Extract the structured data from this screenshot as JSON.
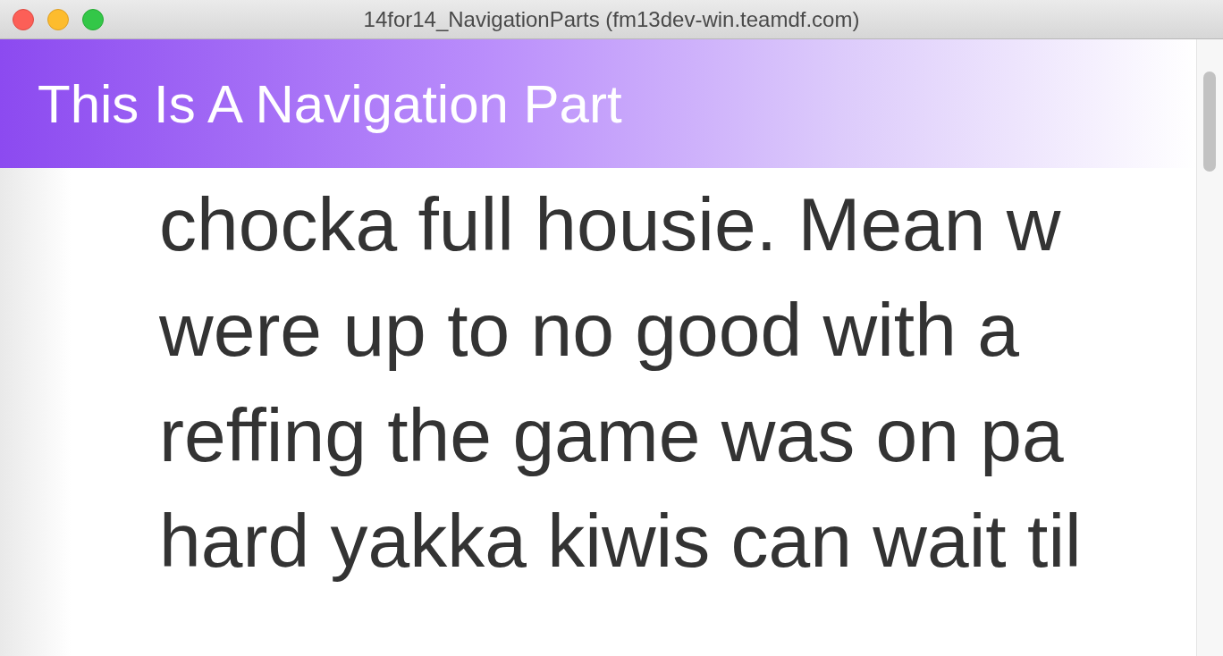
{
  "window": {
    "title": "14for14_NavigationParts (fm13dev-win.teamdf.com)"
  },
  "header": {
    "title": "This Is A Navigation Part"
  },
  "body": {
    "lines": [
      "chocka full housie. Mean w",
      "were up to no good with a",
      "reffing the game was on pa",
      "hard yakka kiwis can wait til"
    ]
  }
}
